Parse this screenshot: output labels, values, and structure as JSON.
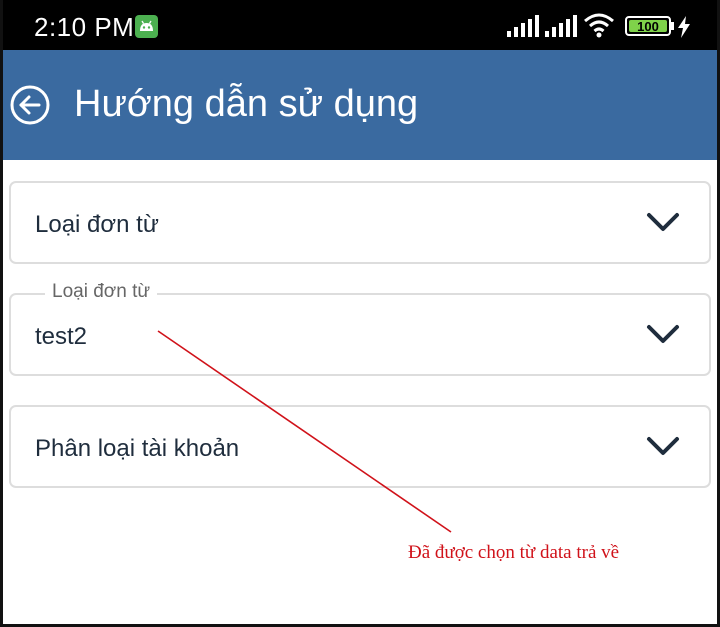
{
  "status_bar": {
    "time": "2:10 PM",
    "battery": "100",
    "icons": [
      "android-icon",
      "signal-icon",
      "signal-icon",
      "wifi-icon",
      "battery-icon",
      "charging-icon"
    ]
  },
  "app_bar": {
    "title": "Hướng dẫn sử dụng",
    "back_icon": "arrow-left-circle-icon",
    "color": "#3a6aa0"
  },
  "fields": [
    {
      "label": "Loại đơn từ",
      "value": "",
      "icon": "chevron-down-icon"
    },
    {
      "label": "Loại đơn từ",
      "value": "test2",
      "icon": "chevron-down-icon"
    },
    {
      "label": "Phân loại tài khoản",
      "value": "",
      "icon": "chevron-down-icon"
    }
  ],
  "annotation": {
    "text": "Đã được chọn từ data trả về",
    "color": "#d0121a"
  }
}
